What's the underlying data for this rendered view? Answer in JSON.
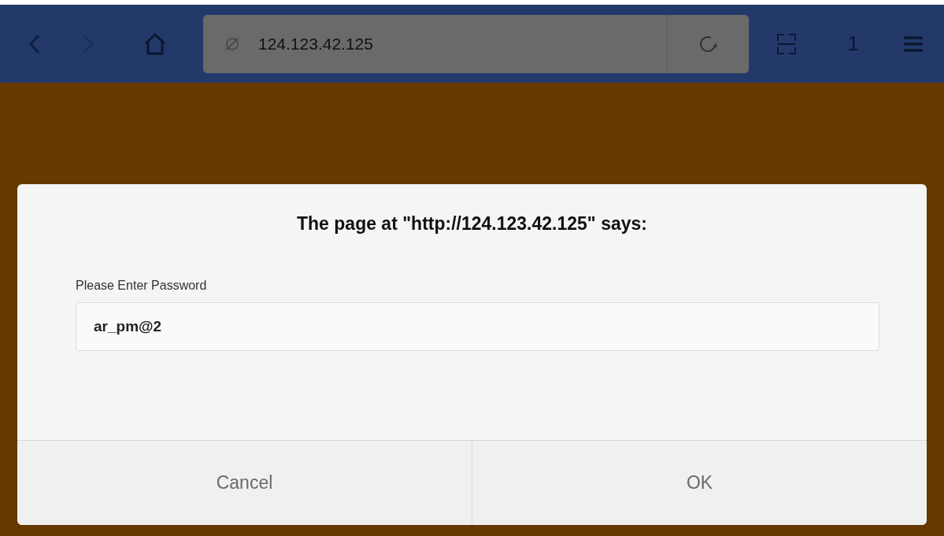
{
  "toolbar": {
    "back": {
      "disabled": false
    },
    "forward": {
      "disabled": true
    },
    "address": "124.123.42.125",
    "tab_count": "1"
  },
  "dialog": {
    "title": "The page at \"http://124.123.42.125\" says:",
    "label": "Please Enter Password",
    "value": "ar_pm@2",
    "buttons": [
      "Cancel",
      "OK"
    ]
  }
}
